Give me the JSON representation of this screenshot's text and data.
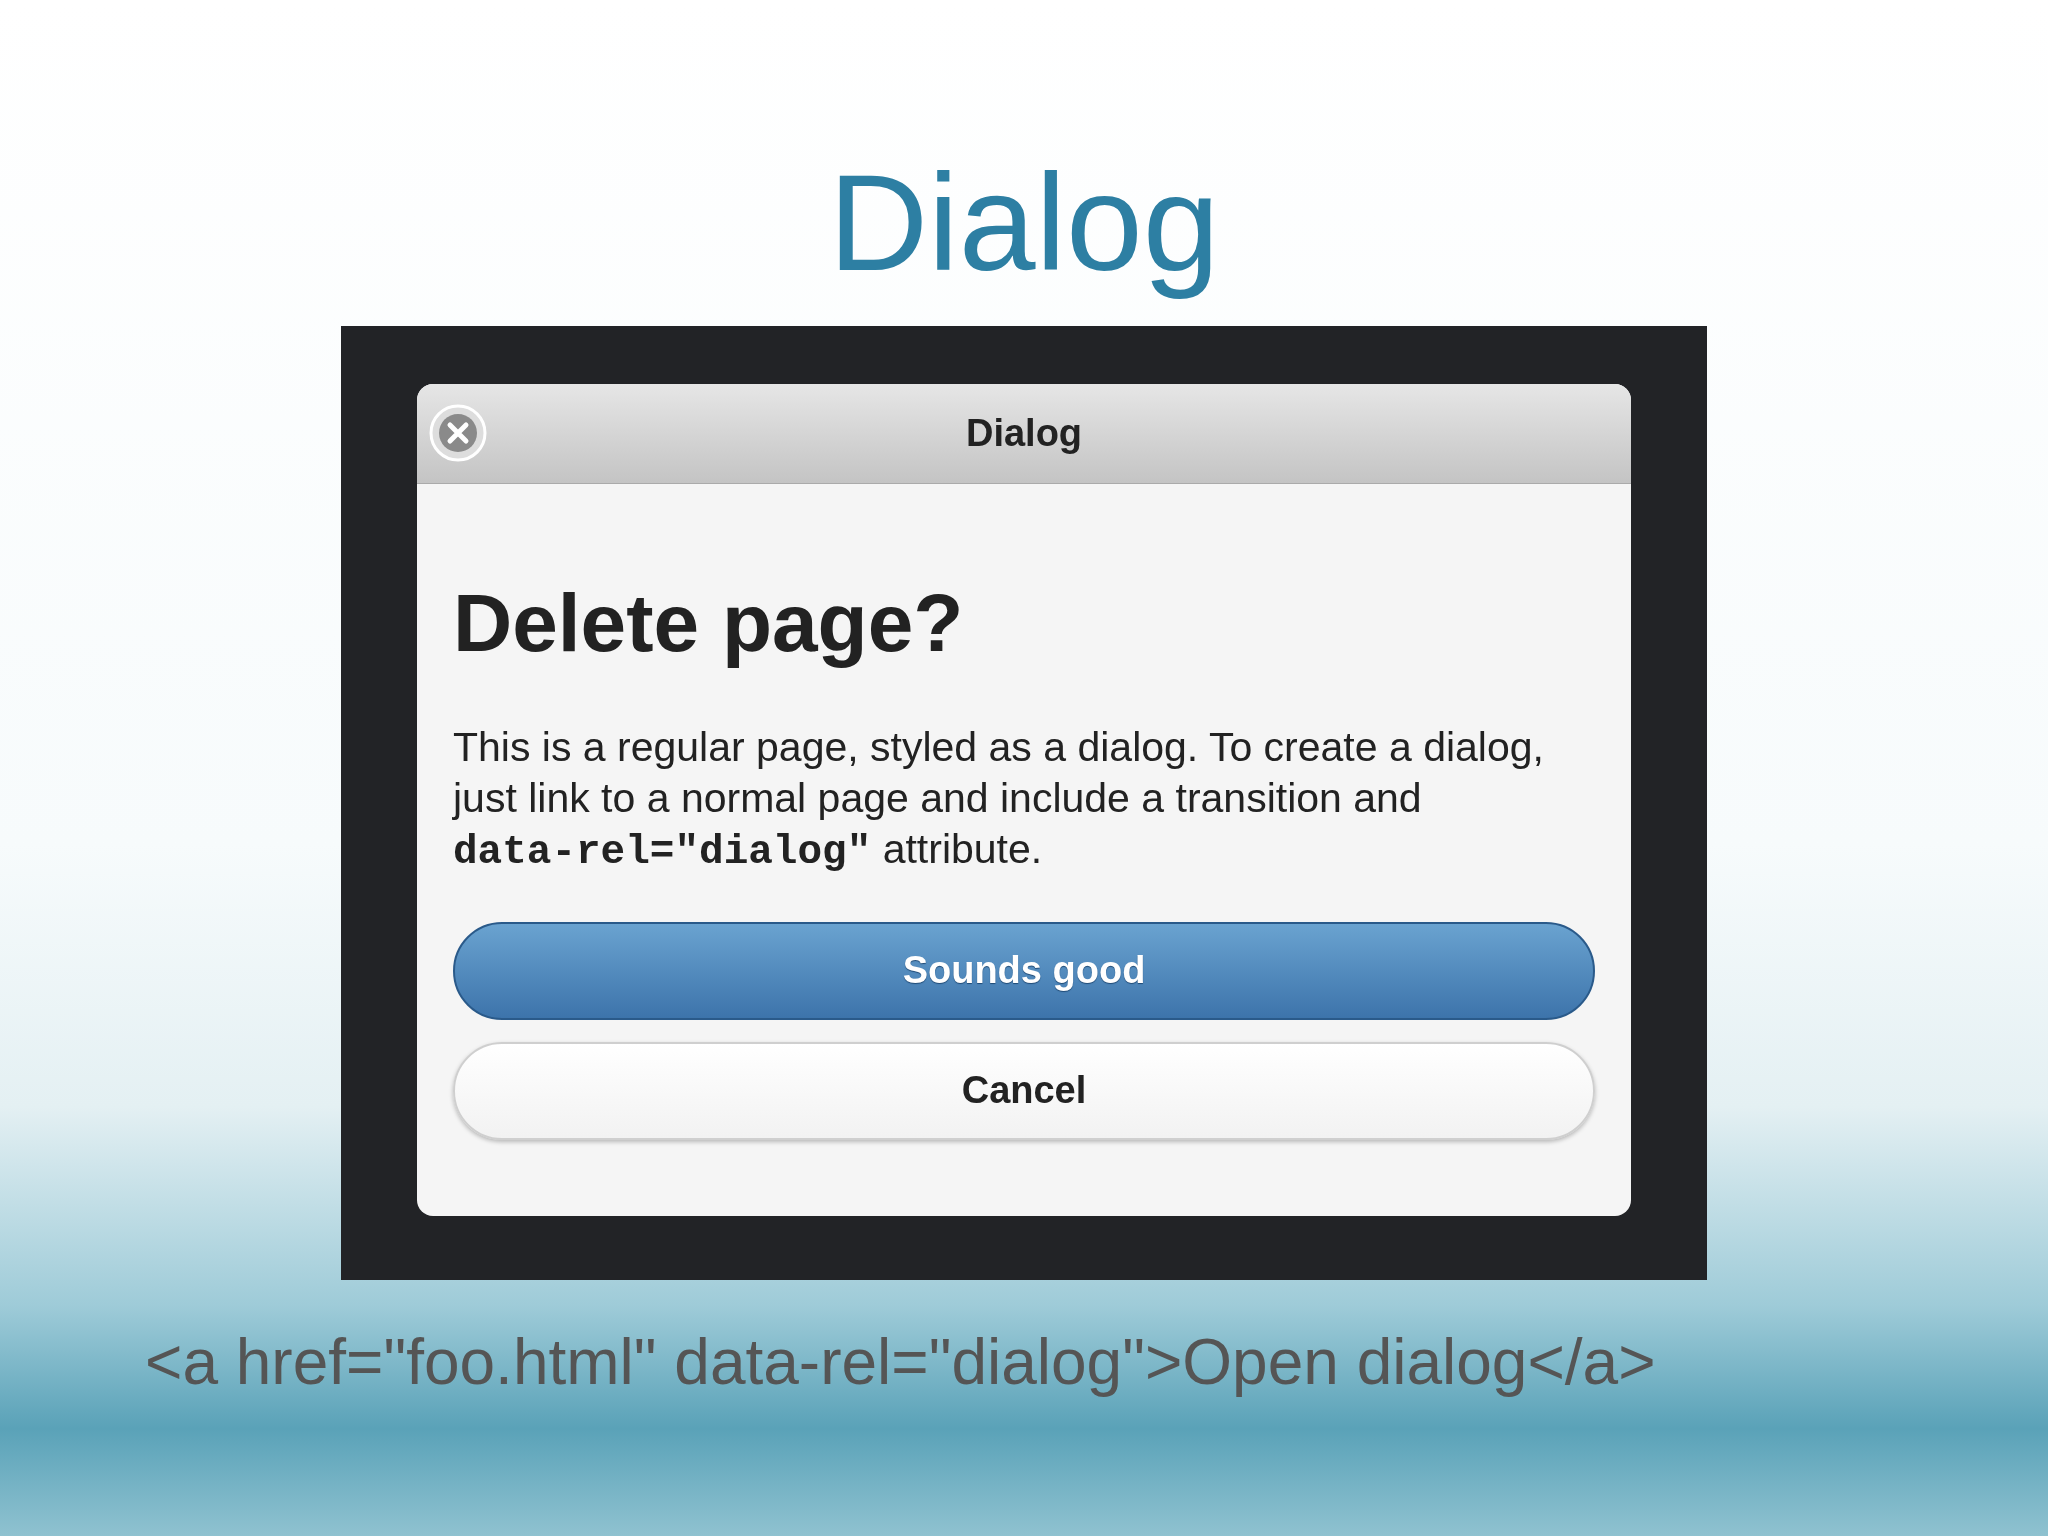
{
  "slide": {
    "title": "Dialog"
  },
  "dialog": {
    "header": "Dialog",
    "heading": "Delete page?",
    "body": "This is a regular page, styled as a dialog. To create a dialog, just link to a normal page and include a transition and **data-rel=\"dialog\"** attribute.",
    "buttons": [
      {
        "label": "Sounds good",
        "kind": "primary"
      },
      {
        "label": "Cancel",
        "kind": "secondary"
      }
    ]
  },
  "code": "<a href=\"foo.html\" data-rel=\"dialog\">Open dialog</a>"
}
